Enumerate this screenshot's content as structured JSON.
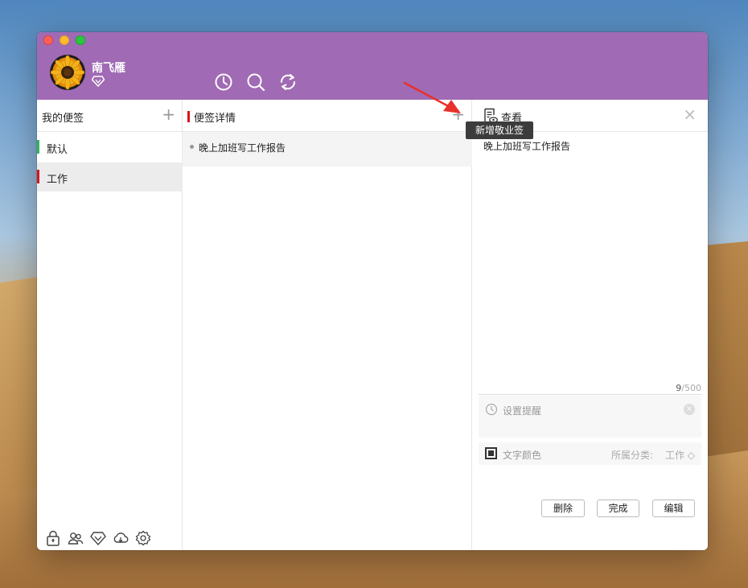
{
  "user": {
    "name": "南飞雁",
    "vip_icon": "diamond-icon"
  },
  "toolbar": {
    "icons": [
      "clock-icon",
      "search-icon",
      "sync-icon"
    ]
  },
  "categories": {
    "title": "我的便签",
    "add_icon": "+",
    "items": [
      {
        "label": "默认",
        "color": "#2fb55c",
        "selected": false
      },
      {
        "label": "工作",
        "color": "#d7141a",
        "selected": true
      }
    ]
  },
  "notes": {
    "title": "便签详情",
    "add_icon": "+",
    "tooltip": "新增敬业签",
    "items": [
      {
        "text": "晚上加班写工作报告"
      }
    ]
  },
  "detail": {
    "title": "查看",
    "close_icon": "×",
    "content": "晚上加班写工作报告",
    "char_count": "9",
    "char_limit": "/500",
    "reminder_label": "设置提醒",
    "text_color_label": "文字颜色",
    "category_label": "所属分类:",
    "category_value": "工作 ◇",
    "buttons": {
      "delete": "删除",
      "done": "完成",
      "edit": "编辑"
    }
  },
  "bottom_tools": [
    "lock-icon",
    "group-icon",
    "vip-icon",
    "cloud-icon",
    "settings-icon"
  ],
  "colors": {
    "header": "#a06ab4",
    "accent_red": "#d7141a",
    "accent_green": "#2fb55c"
  }
}
